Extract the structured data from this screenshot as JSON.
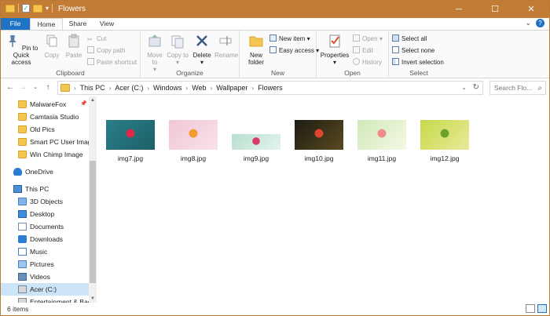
{
  "window": {
    "title": "Flowers",
    "minimize": "─",
    "maximize": "☐",
    "close": "✕",
    "accent": "#c27c35"
  },
  "tabs": [
    {
      "label": "File"
    },
    {
      "label": "Home"
    },
    {
      "label": "Share"
    },
    {
      "label": "View"
    }
  ],
  "ribbon": {
    "clipboard": {
      "label": "Clipboard",
      "pin": "Pin to Quick access",
      "copy": "Copy",
      "paste": "Paste",
      "cut": "Cut",
      "copy_path": "Copy path",
      "paste_shortcut": "Paste shortcut"
    },
    "organize": {
      "label": "Organize",
      "move_to": "Move to",
      "copy_to": "Copy to",
      "delete": "Delete",
      "rename": "Rename"
    },
    "new": {
      "label": "New",
      "new_folder": "New folder",
      "new_item": "New item",
      "easy_access": "Easy access"
    },
    "open": {
      "label": "Open",
      "properties": "Properties",
      "open": "Open",
      "edit": "Edit",
      "history": "History"
    },
    "select": {
      "label": "Select",
      "select_all": "Select all",
      "select_none": "Select none",
      "invert": "Invert selection"
    }
  },
  "address": {
    "crumbs": [
      "This PC",
      "Acer (C:)",
      "Windows",
      "Web",
      "Wallpaper",
      "Flowers"
    ],
    "search_placeholder": "Search Flo..."
  },
  "nav": {
    "items": [
      {
        "label": "MalwareFox",
        "icon": "folder-icon",
        "pinned": true
      },
      {
        "label": "Camtasia Studio",
        "icon": "folder-icon"
      },
      {
        "label": "Old Pics",
        "icon": "folder-icon"
      },
      {
        "label": "Smart PC User Image",
        "icon": "folder-icon"
      },
      {
        "label": "Win Chimp Image",
        "icon": "folder-icon"
      },
      {
        "label": "OneDrive",
        "icon": "cloud-icon"
      },
      {
        "label": "This PC",
        "icon": "computer-icon"
      },
      {
        "label": "3D Objects",
        "icon": "cube-icon"
      },
      {
        "label": "Desktop",
        "icon": "desktop-icon"
      },
      {
        "label": "Documents",
        "icon": "document-icon"
      },
      {
        "label": "Downloads",
        "icon": "download-icon"
      },
      {
        "label": "Music",
        "icon": "music-icon"
      },
      {
        "label": "Pictures",
        "icon": "picture-icon"
      },
      {
        "label": "Videos",
        "icon": "video-icon"
      },
      {
        "label": "Acer (C:)",
        "icon": "drive-icon",
        "selected": true
      },
      {
        "label": "Entertainment & Bac",
        "icon": "drive-icon"
      }
    ]
  },
  "files": [
    {
      "name": "img7.jpg",
      "colors": [
        "#2a7f8a",
        "#1d6068",
        "#e0284a"
      ]
    },
    {
      "name": "img8.jpg",
      "colors": [
        "#f2c6d8",
        "#f7e2ea",
        "#f39b2c"
      ]
    },
    {
      "name": "img9.jpg",
      "colors": [
        "#b8e0cf",
        "#e4f3ec",
        "#d83b6a"
      ]
    },
    {
      "name": "img10.jpg",
      "colors": [
        "#1c1c14",
        "#5a4a1e",
        "#e1452d"
      ]
    },
    {
      "name": "img11.jpg",
      "colors": [
        "#cfe9b8",
        "#f5f8e4",
        "#f08b88"
      ]
    },
    {
      "name": "img12.jpg",
      "colors": [
        "#c6d94a",
        "#e8ea9a",
        "#6ea12c"
      ]
    }
  ],
  "status": {
    "count": "6 items"
  }
}
